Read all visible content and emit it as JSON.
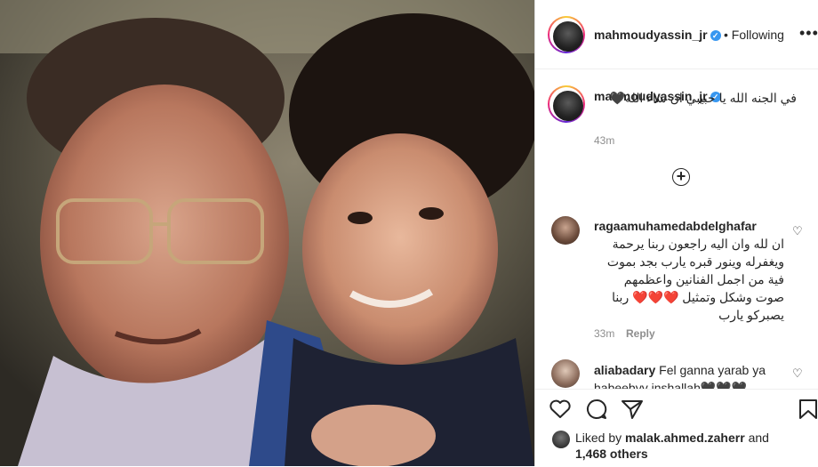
{
  "post": {
    "author": "mahmoudyassin_jr",
    "follow_state": "Following",
    "more_glyph": "•••",
    "caption": "في الجنه الله يا حبيبي ان شاء الله🖤",
    "caption_time": "43m",
    "load_more_glyph": "+"
  },
  "comments": [
    {
      "user": "ragaamuhamedabdelghafar",
      "text": "ان لله وان اليه راجعون ربنا يرحمة ويغفرله وينور قبره يارب بجد بموت فية من اجمل الفنانين واعظمهم صوت وشكل وتمثيل ❤️❤️❤️ ربنا يصبركو يارب",
      "time": "33m",
      "reply": "Reply"
    },
    {
      "user": "aliabadary",
      "text": "Fel ganna yarab ya habeebyy inshallah🖤🖤🖤",
      "time": "",
      "reply": ""
    }
  ],
  "likes": {
    "prefix": "Liked by",
    "user": "malak.ahmed.zaherr",
    "suffix": "and",
    "others": "1,468 others"
  },
  "icons": [
    "heart-icon",
    "comment-icon",
    "share-icon",
    "bookmark-icon",
    "verified-icon",
    "add-circle-icon"
  ],
  "colors": {
    "verified": "#3897f0",
    "muted": "#8e8e8e",
    "text": "#262626",
    "border": "#dbdbdb"
  }
}
